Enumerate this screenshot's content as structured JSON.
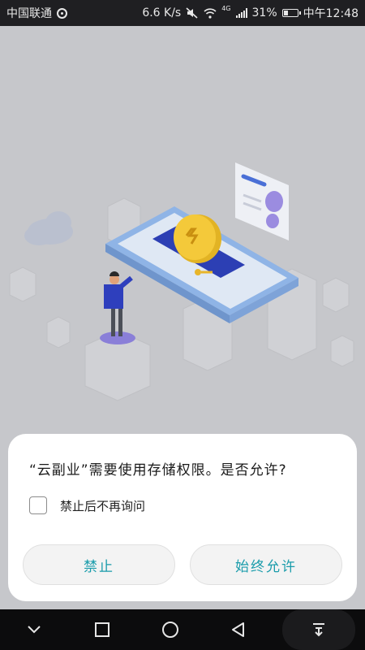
{
  "status_bar": {
    "carrier": "中国联通",
    "speed": "6.6 K/s",
    "network": "4G",
    "battery": "31%",
    "battery_level": 0.31,
    "time": "中午12:48"
  },
  "dialog": {
    "title": "“云副业”需要使用存储权限。是否允许?",
    "checkbox_label": "禁止后不再询问",
    "checkbox_checked": false,
    "deny_label": "禁止",
    "allow_label": "始终允许",
    "accent_color": "#1a9cab"
  },
  "nav_bar": {
    "icons": [
      "chevron-down-icon",
      "recent-apps-icon",
      "home-icon",
      "back-icon",
      "notification-pull-icon"
    ]
  }
}
